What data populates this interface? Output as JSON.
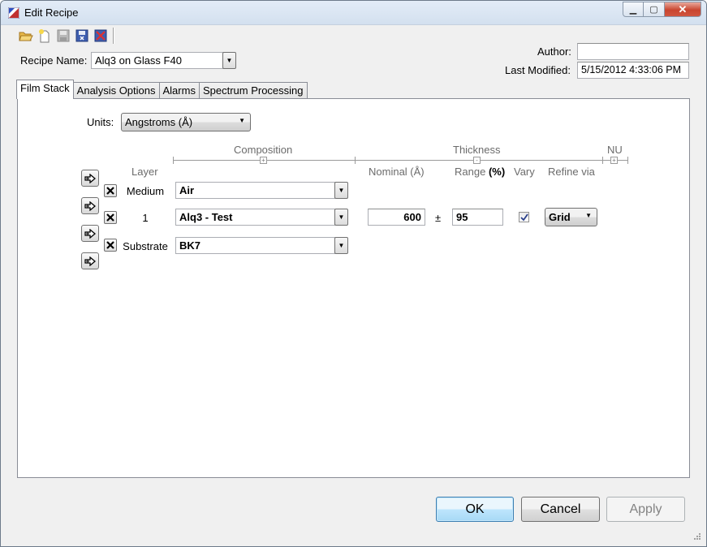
{
  "window": {
    "title": "Edit Recipe"
  },
  "recipe": {
    "name_label": "Recipe Name:",
    "name_value": "Alq3 on Glass F40"
  },
  "meta": {
    "author_label": "Author:",
    "author_value": "",
    "last_modified_label": "Last Modified:",
    "last_modified_value": "5/15/2012 4:33:06 PM"
  },
  "toolbar": {
    "icons": [
      "open-folder-icon",
      "new-recipe-icon",
      "save-icon",
      "save-as-icon",
      "delete-recipe-icon"
    ]
  },
  "tabs": [
    {
      "label": "Film Stack",
      "active": true
    },
    {
      "label": "Analysis Options",
      "active": false
    },
    {
      "label": "Alarms",
      "active": false
    },
    {
      "label": "Spectrum Processing",
      "active": false
    }
  ],
  "film_stack": {
    "units_label": "Units:",
    "units_value": "Angstroms (Å)",
    "headers": {
      "composition": "Composition",
      "thickness": "Thickness",
      "nu": "NU",
      "layer": "Layer",
      "nominal": "Nominal (Å)",
      "range": "Range",
      "range_unit": "(%)",
      "vary": "Vary",
      "refine_via": "Refine via"
    },
    "layers": [
      {
        "layer": "Medium",
        "composition": "Air"
      },
      {
        "layer": "1",
        "composition": "Alq3 - Test",
        "nominal": "600",
        "plusminus": "±",
        "range": "95",
        "vary": true,
        "refine_via": "Grid"
      },
      {
        "layer": "Substrate",
        "composition": "BK7"
      }
    ]
  },
  "buttons": {
    "ok": "OK",
    "cancel": "Cancel",
    "apply": "Apply"
  },
  "colors": {
    "accent": "#3c7fb1",
    "close": "#c9452f"
  }
}
